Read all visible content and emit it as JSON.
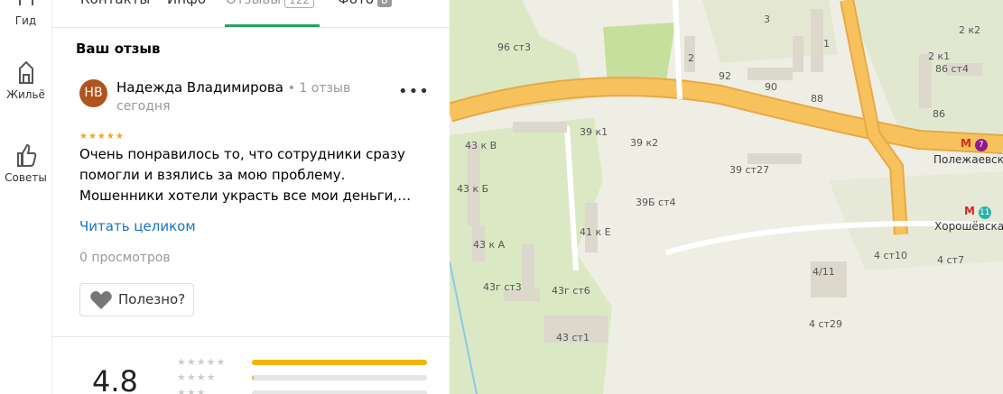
{
  "rail": {
    "items": [
      {
        "label": "Гид",
        "icon": "guide-icon"
      },
      {
        "label": "Жильё",
        "icon": "housing-icon"
      },
      {
        "label": "Советы",
        "icon": "thumbs-up-icon"
      }
    ]
  },
  "tabs": [
    {
      "label": "Контакты"
    },
    {
      "label": "Инфо"
    },
    {
      "label": "Отзывы",
      "badge": "122",
      "active": true
    },
    {
      "label": "Фото",
      "badge": "8"
    }
  ],
  "review_section": {
    "title": "Ваш отзыв",
    "author": {
      "initials": "НВ",
      "name": "Надежда Владимирова",
      "review_count": "1 отзыв",
      "avatar_color": "#b0541d"
    },
    "date": "сегодня",
    "stars": "★★★★★",
    "text": "Очень понравилось то, что сотрудники сразу\nпомогли и взялись за мою проблему.\nМошенники хотели украсть все мои деньги,…",
    "read_more": "Читать целиком",
    "views": "0 просмотров",
    "useful_label": "Полезно?"
  },
  "rating": {
    "value": "4.8",
    "rows": [
      {
        "stars": "★★★★★",
        "fraction": 1.0
      },
      {
        "stars": "★★★★",
        "fraction": 0.01
      },
      {
        "stars": "★★★",
        "fraction": 0.0
      }
    ],
    "bar_color": "#f5b400"
  },
  "map": {
    "labels": [
      {
        "text": "96 ст3"
      },
      {
        "text": "2"
      },
      {
        "text": "92"
      },
      {
        "text": "90"
      },
      {
        "text": "88"
      },
      {
        "text": "1"
      },
      {
        "text": "3"
      },
      {
        "text": "2 к1"
      },
      {
        "text": "2 к2"
      },
      {
        "text": "86 ст4"
      },
      {
        "text": "86"
      },
      {
        "text": "43 к В"
      },
      {
        "text": "39 к1"
      },
      {
        "text": "39 к2"
      },
      {
        "text": "39 ст27"
      },
      {
        "text": "43 к Б"
      },
      {
        "text": "39Б ст4"
      },
      {
        "text": "43 к А"
      },
      {
        "text": "41 к Е"
      },
      {
        "text": "43г ст3"
      },
      {
        "text": "43г ст6"
      },
      {
        "text": "43 ст1"
      },
      {
        "text": "4/11"
      },
      {
        "text": "4 ст10"
      },
      {
        "text": "4 ст7"
      },
      {
        "text": "4 ст29"
      }
    ],
    "metro": [
      {
        "name": "Полежаевская",
        "line": "7",
        "color": "#8d1b89"
      },
      {
        "name": "Хорошёвская",
        "line": "11",
        "color": "#29b1a6"
      }
    ],
    "road_color": "#f7c25c",
    "park_color": "#cfe3a7"
  }
}
